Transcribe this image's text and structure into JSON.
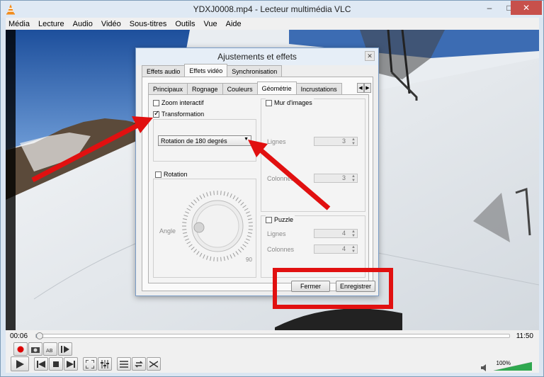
{
  "window": {
    "title": "YDXJ0008.mp4 - Lecteur multimédia VLC",
    "minimize": "–",
    "maximize": "□",
    "close": "✕"
  },
  "menu": [
    "Média",
    "Lecture",
    "Audio",
    "Vidéo",
    "Sous-titres",
    "Outils",
    "Vue",
    "Aide"
  ],
  "dialog": {
    "title": "Ajustements et effets",
    "close": "✕",
    "tabs": [
      "Effets audio",
      "Effets vidéo",
      "Synchronisation"
    ],
    "active_tab": "Effets vidéo",
    "subtabs": [
      "Principaux",
      "Rognage",
      "Couleurs",
      "Géométrie",
      "Incrustations"
    ],
    "active_subtab": "Géométrie",
    "zoom_label": "Zoom interactif",
    "zoom_checked": false,
    "transform_label": "Transformation",
    "transform_checked": true,
    "transform_value": "Rotation de 180 degrés",
    "rotation_label": "Rotation",
    "rotation_checked": false,
    "angle_label": "Angle",
    "angle_value": "90",
    "wall_label": "Mur d'images",
    "wall_checked": false,
    "rows_label": "Lignes",
    "rows_value": "3",
    "cols_label": "Colonnes",
    "cols_value": "3",
    "puzzle_label": "Puzzle",
    "puzzle_checked": false,
    "puzzle_rows_label": "Lignes",
    "puzzle_rows_value": "4",
    "puzzle_cols_label": "Colonnes",
    "puzzle_cols_value": "4",
    "close_button": "Fermer",
    "save_button": "Enregistrer"
  },
  "player": {
    "time_elapsed": "00:06",
    "time_total": "11:50",
    "progress": 0.008,
    "volume_label": "100%",
    "volume": 1.0
  },
  "colors": {
    "annotation": "#e11010",
    "accent": "#4a90d9"
  }
}
